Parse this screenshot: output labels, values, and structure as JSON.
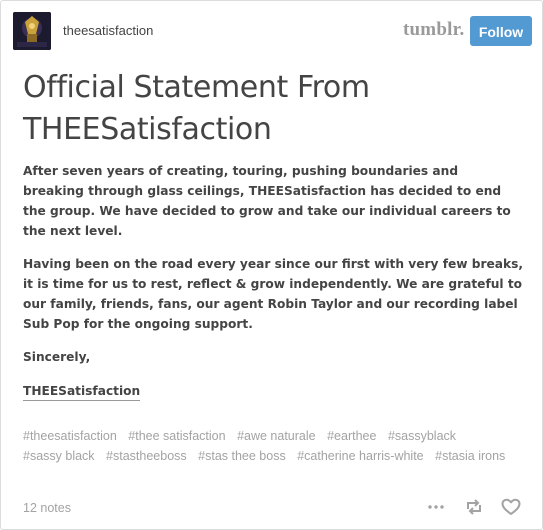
{
  "header": {
    "blog_name": "theesatisfaction",
    "tumblr_logo_text": "tumblr.",
    "follow_label": "Follow",
    "follow_color": "#539ad3"
  },
  "post": {
    "title": "Official Statement From THEESatisfaction",
    "paragraphs": [
      "After seven years of creating, touring, pushing boundaries and breaking through glass ceilings, THEESatisfaction has decided to end the group. We have decided to grow and take our individual careers to the next level.",
      "Having been on the road every year since our first with very few breaks, it is time for us to rest, reflect & grow independently. We are grateful to our family, friends, fans, our agent Robin Taylor and our recording label Sub Pop for the ongoing support.",
      "Sincerely,"
    ],
    "signature": "THEESatisfaction",
    "tags": [
      "#theesatisfaction",
      "#thee satisfaction",
      "#awe naturale",
      "#earthee",
      "#sassyblack",
      "#sassy black",
      "#stastheeboss",
      "#stas thee boss",
      "#catherine harris-white",
      "#stasia irons"
    ]
  },
  "footer": {
    "notes": "12 notes",
    "icons": [
      "more-icon",
      "reblog-icon",
      "like-icon"
    ]
  }
}
